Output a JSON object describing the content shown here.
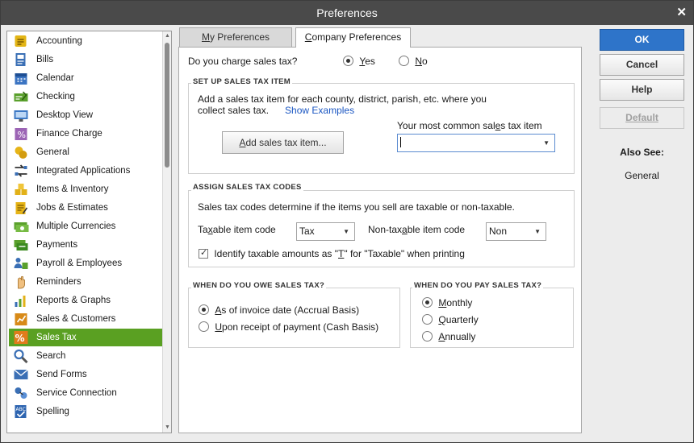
{
  "window": {
    "title": "Preferences"
  },
  "sidebar": {
    "items": [
      {
        "label": "Accounting",
        "icon": "accounting-icon"
      },
      {
        "label": "Bills",
        "icon": "bills-icon"
      },
      {
        "label": "Calendar",
        "icon": "calendar-icon"
      },
      {
        "label": "Checking",
        "icon": "checking-icon"
      },
      {
        "label": "Desktop View",
        "icon": "desktop-view-icon"
      },
      {
        "label": "Finance Charge",
        "icon": "finance-charge-icon"
      },
      {
        "label": "General",
        "icon": "general-icon"
      },
      {
        "label": "Integrated Applications",
        "icon": "integrated-applications-icon"
      },
      {
        "label": "Items & Inventory",
        "icon": "items-inventory-icon"
      },
      {
        "label": "Jobs & Estimates",
        "icon": "jobs-estimates-icon"
      },
      {
        "label": "Multiple Currencies",
        "icon": "multiple-currencies-icon"
      },
      {
        "label": "Payments",
        "icon": "payments-icon"
      },
      {
        "label": "Payroll & Employees",
        "icon": "payroll-employees-icon"
      },
      {
        "label": "Reminders",
        "icon": "reminders-icon"
      },
      {
        "label": "Reports & Graphs",
        "icon": "reports-graphs-icon"
      },
      {
        "label": "Sales & Customers",
        "icon": "sales-customers-icon"
      },
      {
        "label": "Sales Tax",
        "icon": "sales-tax-icon"
      },
      {
        "label": "Search",
        "icon": "search-icon"
      },
      {
        "label": "Send Forms",
        "icon": "send-forms-icon"
      },
      {
        "label": "Service Connection",
        "icon": "service-connection-icon"
      },
      {
        "label": "Spelling",
        "icon": "spelling-icon"
      }
    ],
    "selected": "Sales Tax"
  },
  "tabs": {
    "my_first": "M",
    "my_rest": "y Preferences",
    "company_first": "C",
    "company_rest": "ompany Preferences"
  },
  "charge": {
    "question": "Do you charge sales tax?",
    "yes_first": "Y",
    "yes_rest": "es",
    "no_first": "N",
    "no_rest": "o",
    "selected": "Yes"
  },
  "setup": {
    "title": "SET UP SALES TAX ITEM",
    "desc_line1": "Add a sales tax item for each county, district, parish, etc. where you",
    "desc_line2": "collect sales tax.",
    "show_examples": "Show Examples",
    "add_btn_first": "A",
    "add_btn_rest": "dd sales tax item...",
    "common_pre": "Your most common sal",
    "common_u": "e",
    "common_post": "s tax item",
    "common_value": ""
  },
  "codes": {
    "title": "ASSIGN SALES TAX CODES",
    "desc": "Sales tax codes determine if the items you sell are taxable or non-taxable.",
    "taxable_pre": "Ta",
    "taxable_u": "x",
    "taxable_post": "able item code",
    "taxable_value": "Tax",
    "nontaxable_pre": "Non-tax",
    "nontaxable_u": "a",
    "nontaxable_post": "ble item code",
    "nontaxable_value": "Non",
    "identify_pre": "Identify taxable amounts as \"",
    "identify_u": "T",
    "identify_post": "\" for \"Taxable\" when printing",
    "identify_checked": true
  },
  "owe": {
    "title": "WHEN DO YOU OWE SALES TAX?",
    "opt1_first": "A",
    "opt1_rest": "s of invoice date (Accrual Basis)",
    "opt2_first": "U",
    "opt2_rest": "pon receipt of payment (Cash Basis)",
    "selected": "As of invoice date (Accrual Basis)"
  },
  "pay": {
    "title": "WHEN DO YOU PAY SALES TAX?",
    "opt1_first": "M",
    "opt1_rest": "onthly",
    "opt2_first": "Q",
    "opt2_rest": "uarterly",
    "opt3_first": "A",
    "opt3_rest": "nnually",
    "selected": "Monthly"
  },
  "buttons": {
    "ok": "OK",
    "cancel": "Cancel",
    "help": "Help",
    "default": "Default"
  },
  "also_see": {
    "title": "Also See:",
    "link": "General"
  },
  "colors": {
    "selected_item": "#5aa022",
    "ok_button": "#2e74c9",
    "titlebar": "#4a4a4a",
    "link": "#1a56c2"
  }
}
